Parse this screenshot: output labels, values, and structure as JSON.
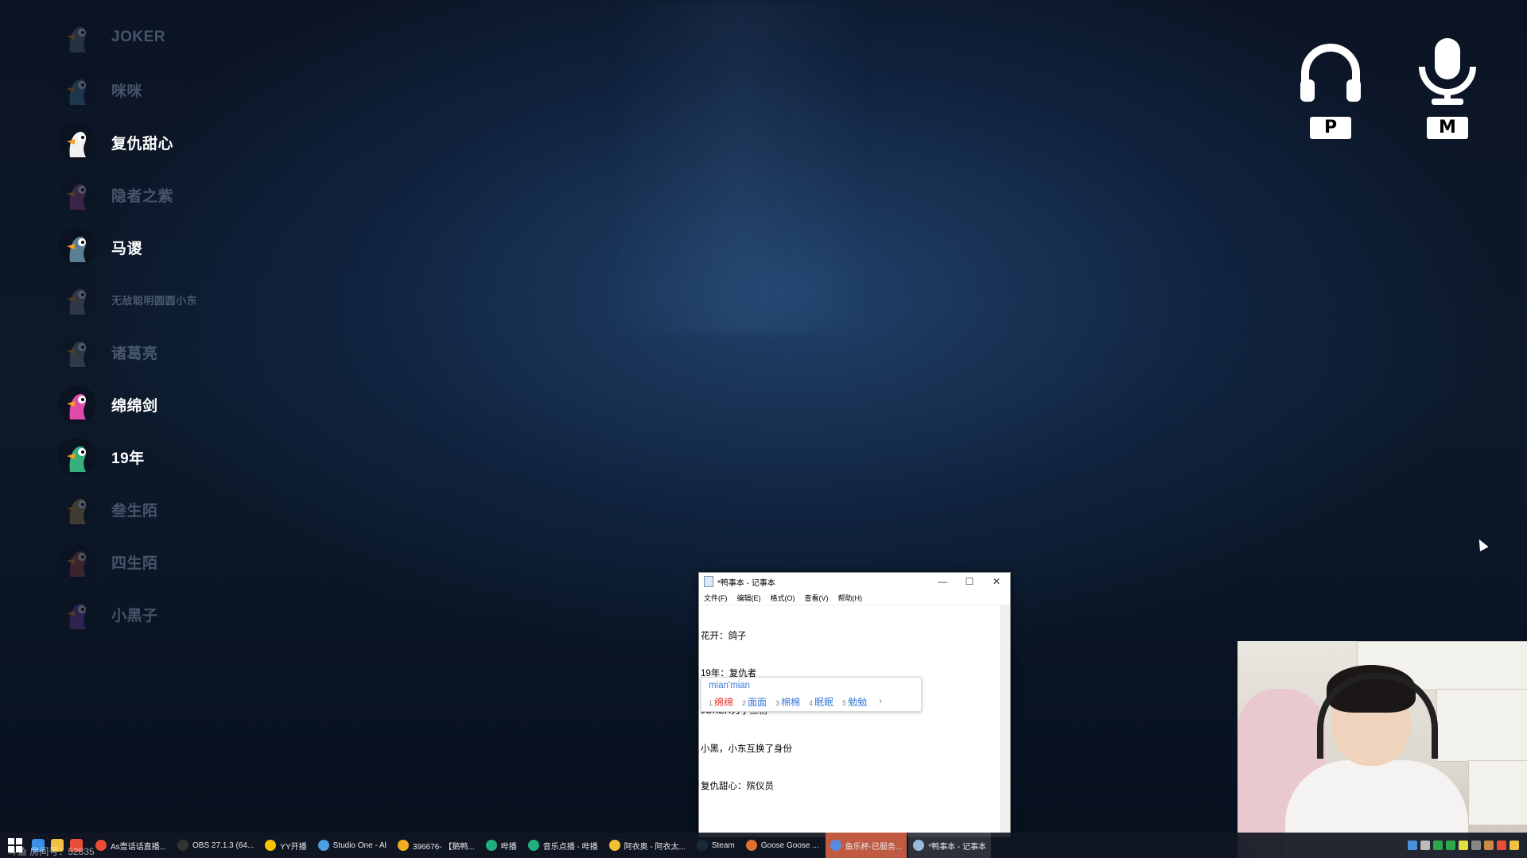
{
  "players": [
    {
      "name": "JOKER",
      "color": "#6b7d95",
      "alive": false,
      "small": false
    },
    {
      "name": "咪咪",
      "color": "#4a8ab0",
      "alive": false,
      "small": false
    },
    {
      "name": "复仇甜心",
      "color": "#f0f0f0",
      "alive": true,
      "small": false
    },
    {
      "name": "隐者之紫",
      "color": "#b24a9a",
      "alive": false,
      "small": false
    },
    {
      "name": "马谡",
      "color": "#5b7e95",
      "alive": true,
      "small": false
    },
    {
      "name": "无敌聪明圆圆小东",
      "color": "#8a8a8a",
      "alive": false,
      "small": true
    },
    {
      "name": "诸葛亮",
      "color": "#8a8a8a",
      "alive": false,
      "small": false
    },
    {
      "name": "绵绵剑",
      "color": "#e04aa8",
      "alive": true,
      "small": false
    },
    {
      "name": "19年",
      "color": "#34b07a",
      "alive": true,
      "small": false
    },
    {
      "name": "叁生陌",
      "color": "#c09a52",
      "alive": false,
      "small": false
    },
    {
      "name": "四生陌",
      "color": "#b84a3a",
      "alive": false,
      "small": false
    },
    {
      "name": "小黑子",
      "color": "#8a4ac0",
      "alive": false,
      "small": false
    }
  ],
  "hud": {
    "headphones": {
      "icon": "headphones-icon",
      "key": "P"
    },
    "microphone": {
      "icon": "microphone-icon",
      "key": "M"
    }
  },
  "notepad": {
    "title": "*鸭事本 - 记事本",
    "menu": [
      "文件(F)",
      "编辑(E)",
      "格式(O)",
      "查看(V)",
      "帮助(H)"
    ],
    "lines": [
      "花开：鸽子",
      "19年：复仇者",
      "JOKER刀了三楞",
      "小黑，小东互换了身份",
      "复仇甜心：殡仪员"
    ],
    "ime": {
      "pinyin": "mian'mian",
      "candidates": [
        {
          "n": "1",
          "text": "绵绵",
          "selected": true
        },
        {
          "n": "2",
          "text": "面面",
          "selected": false
        },
        {
          "n": "3",
          "text": "棉棉",
          "selected": false
        },
        {
          "n": "4",
          "text": "眠眠",
          "selected": false
        },
        {
          "n": "5",
          "text": "勉勉",
          "selected": false
        }
      ],
      "more": "›"
    }
  },
  "taskbar": {
    "items": [
      {
        "label": "As壹话话直播...",
        "color": "#e94d3a",
        "state": ""
      },
      {
        "label": "OBS 27.1.3 (64...",
        "color": "#333333",
        "state": ""
      },
      {
        "label": "YY开播",
        "color": "#f5c400",
        "state": ""
      },
      {
        "label": "Studio One - Al",
        "color": "#4aa0e0",
        "state": ""
      },
      {
        "label": "396676- 【鹅鸭...",
        "color": "#f0b020",
        "state": ""
      },
      {
        "label": "哔播",
        "color": "#20b080",
        "state": ""
      },
      {
        "label": "音乐点播 - 哔播",
        "color": "#20b080",
        "state": ""
      },
      {
        "label": "阿衣奥 - 阿衣太...",
        "color": "#f0c030",
        "state": ""
      },
      {
        "label": "Steam",
        "color": "#1b2838",
        "state": ""
      },
      {
        "label": "Goose Goose ...",
        "color": "#e07030",
        "state": ""
      },
      {
        "label": "鱼乐杯-已服务...",
        "color": "#5a8ae0",
        "state": "active"
      },
      {
        "label": "*鸭事本 - 记事本",
        "color": "#9ab8d8",
        "state": "active2"
      }
    ],
    "room_id": "斗鱼 房间号：52835"
  }
}
